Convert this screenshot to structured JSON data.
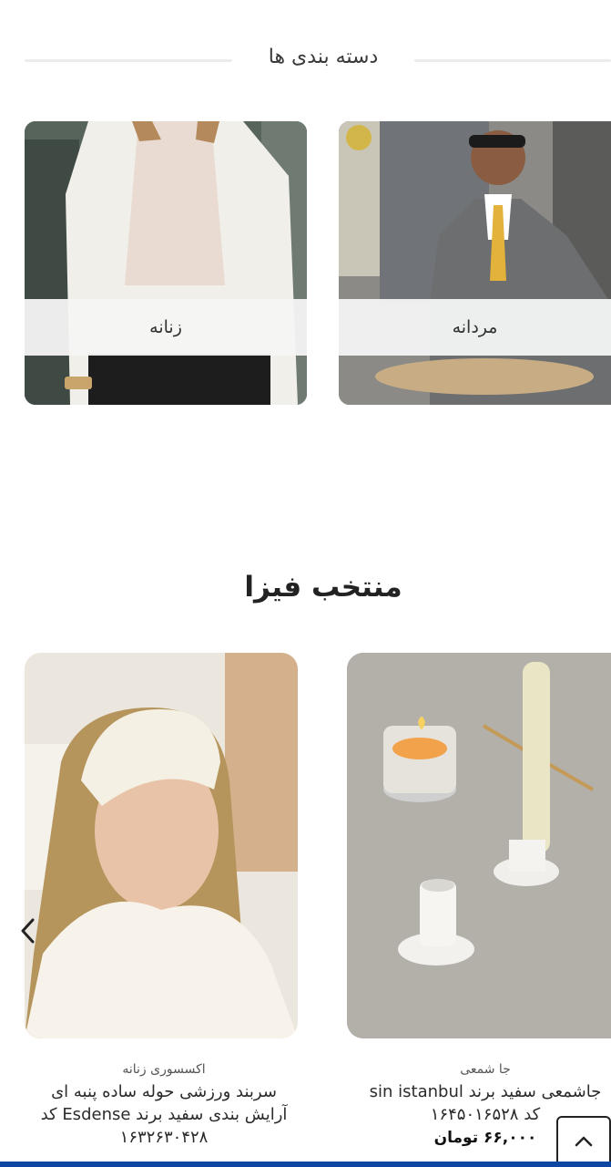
{
  "categories": {
    "title": "دسته بندی ها",
    "items": [
      {
        "label": "مردانه"
      },
      {
        "label": "زنانه"
      }
    ]
  },
  "featured": {
    "title": "منتخب فیزا",
    "products": [
      {
        "category": "جا شمعی",
        "name": "جاشمعی سفید برند sin istanbul کد ۱۶۴۵۰۱۶۵۲۸",
        "price": "۶۶,۰۰۰ تومان"
      },
      {
        "category": "اکسسوری زنانه",
        "name": "سربند ورزشی حوله ساده پنبه ای آرایش بندی سفید برند Esdense کد ۱۶۳۲۶۳۰۴۲۸",
        "price": ""
      }
    ]
  },
  "icons": {
    "prev_arrow": "chevron-left-icon",
    "scroll_top": "chevron-up-icon"
  },
  "colors": {
    "bottom_bar": "#0d47a1",
    "divider": "#ececec"
  }
}
